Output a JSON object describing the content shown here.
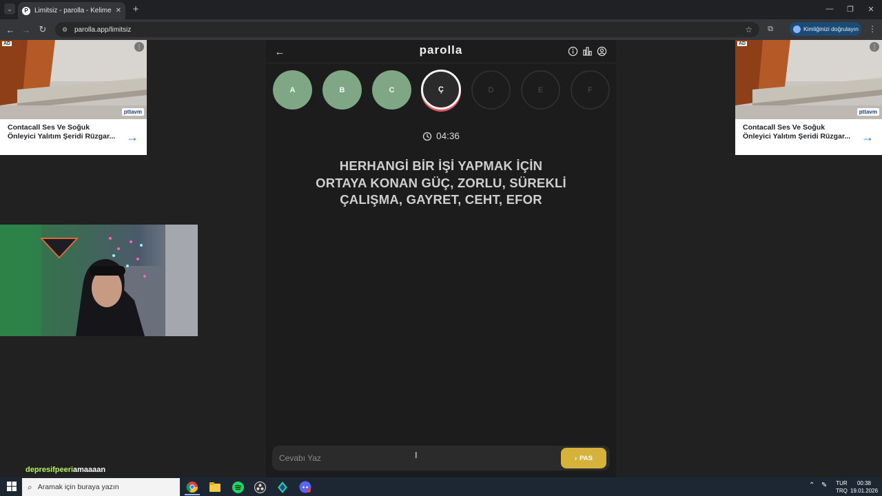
{
  "browser": {
    "tab_title": "Limitsiz - parolla - Kelime oyunu",
    "tab_favicon": "P",
    "url": "parolla.app/limitsiz",
    "verify_label": "Kimliğinizi doğrulayın"
  },
  "ads": {
    "tag": "AD",
    "brand": "pttavm",
    "text": "Contacall Ses Ve Soğuk Önleyici Yalıtım Şeridi Rüzgar..."
  },
  "chat": {
    "user": "depresifpeeri",
    "message": "amaaaan"
  },
  "app": {
    "logo": "parolla",
    "letters": [
      {
        "label": "A",
        "state": "done"
      },
      {
        "label": "B",
        "state": "done"
      },
      {
        "label": "C",
        "state": "done"
      },
      {
        "label": "Ç",
        "state": "active"
      },
      {
        "label": "D",
        "state": "todo"
      },
      {
        "label": "E",
        "state": "todo"
      },
      {
        "label": "F",
        "state": "todo"
      }
    ],
    "timer": "04:36",
    "question_lines": [
      "HERHANGİ BİR İŞİ YAPMAK İÇİN",
      "ORTAYA KONAN GÜÇ, ZORLU, SÜREKLİ",
      "ÇALIŞMA, GAYRET, CEHT, EFOR"
    ],
    "answer_placeholder": "Cevabı Yaz",
    "pass_label": "PAS"
  },
  "taskbar": {
    "search_placeholder": "Aramak için buraya yazın",
    "lang_top": "TUR",
    "lang_bottom": "TRQ",
    "time": "00:38",
    "date": "19.01.2026"
  },
  "colors": {
    "done_circle": "#7fa685",
    "active_ring": "#e05a64",
    "pass_button": "#d6b23a",
    "chat_user": "#b8f25c"
  }
}
